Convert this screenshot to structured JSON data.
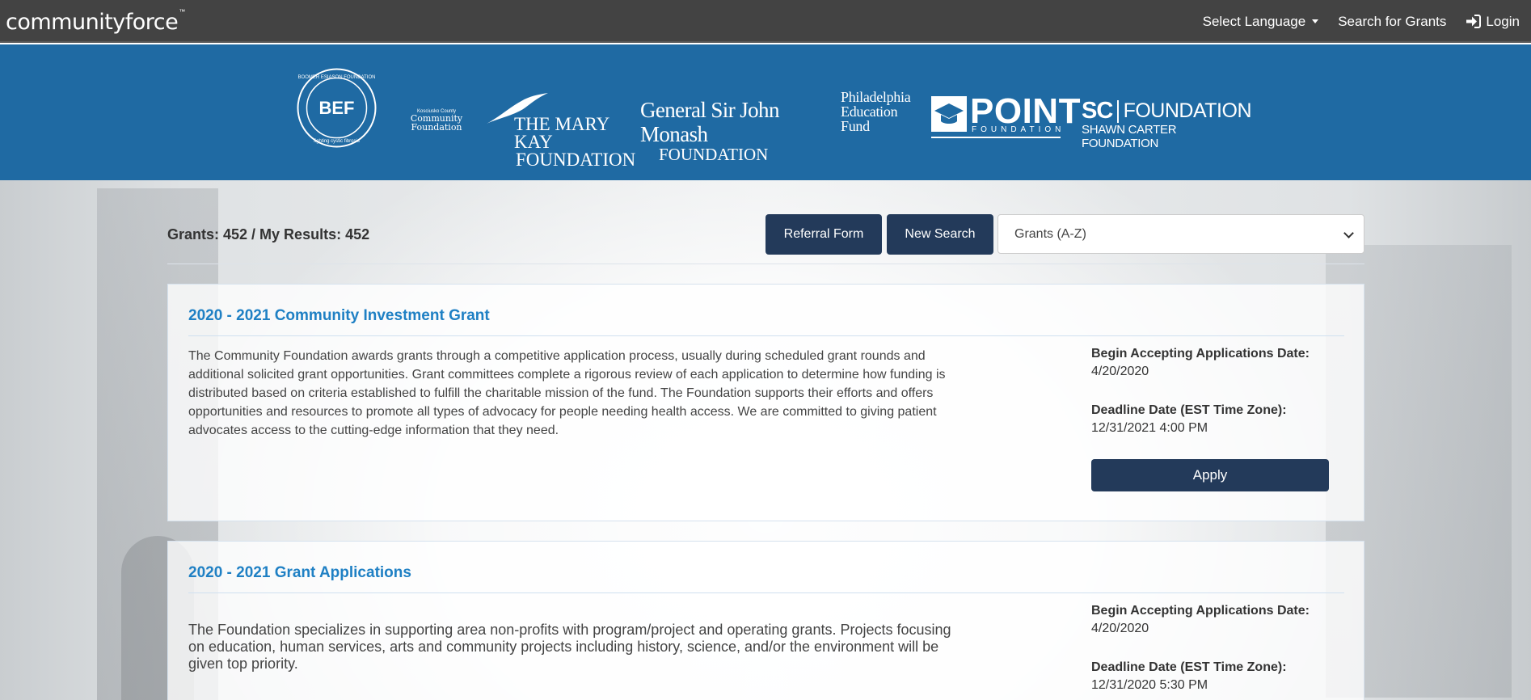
{
  "nav": {
    "brand": "communityforce",
    "brand_tm": "™",
    "select_language": "Select Language",
    "search_grants": "Search for Grants",
    "login": "Login"
  },
  "banner": {
    "logos": {
      "bef_initials": "BEF",
      "bef_ring_top": "BOOMER ESIASON FOUNDATION",
      "bef_ring_bottom": "fighting cystic fibrosis",
      "kc_small": "Kosciusko County",
      "kc_line1": "Community",
      "kc_line2": "Foundation",
      "marykay_line1": "THE MARY KAY",
      "marykay_line2": "FOUNDATION",
      "monash_line1": "General Sir John Monash",
      "monash_line2": "FOUNDATION",
      "phil_line1": "Philadelphia",
      "phil_line2": "Education",
      "phil_line3": "Fund",
      "point_word": "POINT",
      "point_sub": "FOUNDATION",
      "sc_short": "SC",
      "sc_foundation": "FOUNDATION",
      "sc_sub": "SHAWN CARTER FOUNDATION"
    }
  },
  "toolbar": {
    "results_text": "Grants: 452 / My Results: 452",
    "referral_label": "Referral Form",
    "new_search_label": "New Search",
    "sort_selected": "Grants (A-Z)"
  },
  "grants": [
    {
      "title": "2020 - 2021 Community Investment Grant",
      "description": "The Community Foundation awards grants through a competitive application process, usually during scheduled grant rounds and additional solicited grant opportunities. Grant committees complete a rigorous review of each application to determine how funding is distributed based on criteria established to fulfill the charitable mission of the fund. The Foundation supports their efforts and offers opportunities and resources to promote all types of advocacy for people needing health access. We are committed to giving patient advocates access to the cutting-edge information that they need.",
      "begin_label": "Begin Accepting Applications Date:",
      "begin_value": "4/20/2020",
      "deadline_label": "Deadline Date (EST Time Zone):",
      "deadline_value": "12/31/2021 4:00 PM",
      "apply_label": "Apply"
    },
    {
      "title": "2020 - 2021 Grant Applications",
      "description": "The Foundation specializes in supporting area non-profits with program/project and operating grants.  Projects focusing on education, human services, arts and community projects including history, science, and/or the environment will be given top priority.",
      "begin_label": "Begin Accepting Applications Date:",
      "begin_value": "4/20/2020",
      "deadline_label": "Deadline Date (EST Time Zone):",
      "deadline_value": "12/31/2020 5:30 PM"
    }
  ],
  "colors": {
    "nav_bg": "#434343",
    "banner_bg": "#1f6aa3",
    "button_bg": "#233a5a",
    "title_link": "#1f80c4"
  }
}
